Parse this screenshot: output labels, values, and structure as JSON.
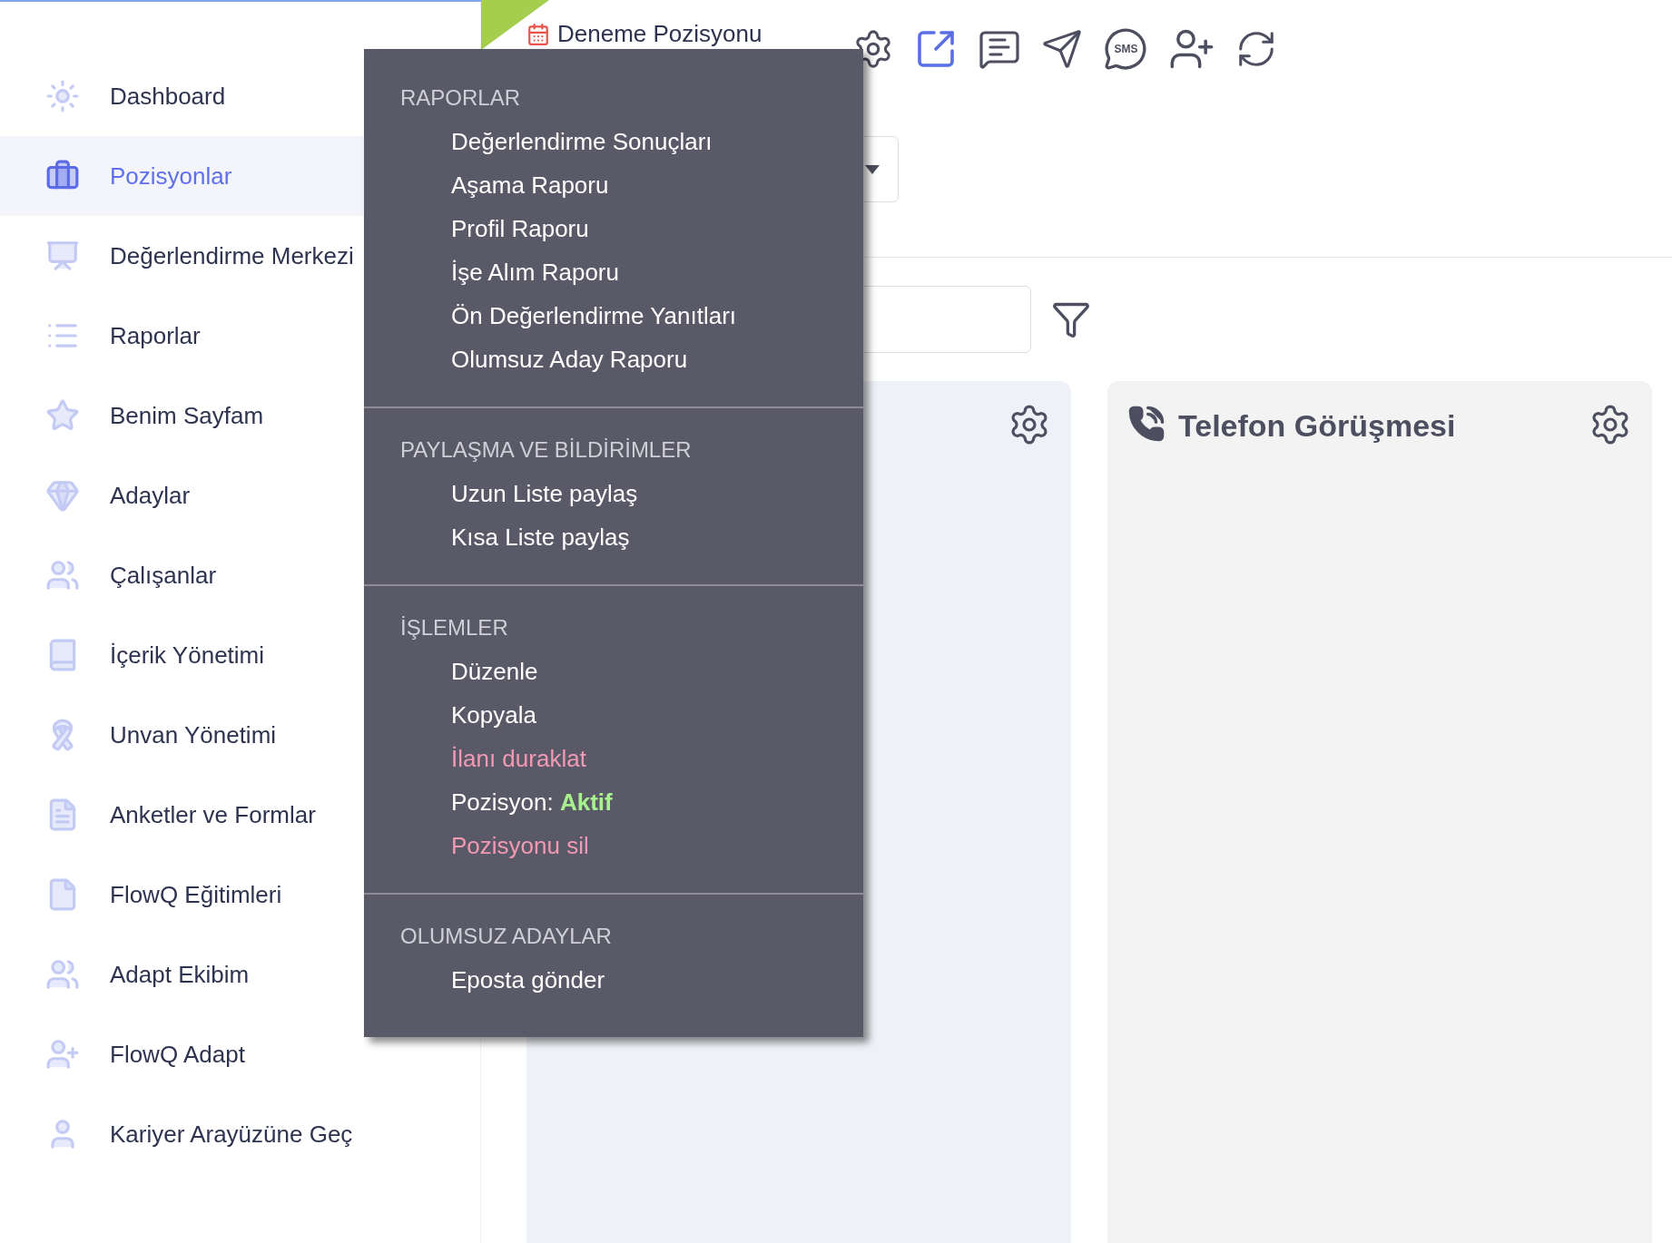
{
  "sidebar": {
    "items": [
      {
        "label": "Dashboard",
        "selected": false
      },
      {
        "label": "Pozisyonlar",
        "selected": true
      },
      {
        "label": "Değerlendirme Merkezi",
        "selected": false
      },
      {
        "label": "Raporlar",
        "selected": false
      },
      {
        "label": "Benim Sayfam",
        "selected": false
      },
      {
        "label": "Adaylar",
        "selected": false
      },
      {
        "label": "Çalışanlar",
        "selected": false
      },
      {
        "label": "İçerik Yönetimi",
        "selected": false
      },
      {
        "label": "Unvan Yönetimi",
        "selected": false
      },
      {
        "label": "Anketler ve Formlar",
        "selected": false
      },
      {
        "label": "FlowQ Eğitimleri",
        "selected": false
      },
      {
        "label": "Adapt Ekibim",
        "selected": false
      },
      {
        "label": "FlowQ Adapt",
        "selected": false
      },
      {
        "label": "Kariyer Arayüzüne Geç",
        "selected": false
      }
    ]
  },
  "header": {
    "title": "Deneme Pozisyonu",
    "sms_label": "SMS"
  },
  "menu": {
    "sections": [
      {
        "heading": "RAPORLAR",
        "items": [
          {
            "label": "Değerlendirme Sonuçları",
            "kind": "normal"
          },
          {
            "label": "Aşama Raporu",
            "kind": "normal"
          },
          {
            "label": "Profil Raporu",
            "kind": "normal"
          },
          {
            "label": "İşe Alım Raporu",
            "kind": "normal"
          },
          {
            "label": "Ön Değerlendirme Yanıtları",
            "kind": "normal"
          },
          {
            "label": "Olumsuz Aday Raporu",
            "kind": "normal"
          }
        ]
      },
      {
        "heading": "PAYLAŞMA VE BİLDİRİMLER",
        "items": [
          {
            "label": "Uzun Liste paylaş",
            "kind": "normal"
          },
          {
            "label": "Kısa Liste paylaş",
            "kind": "normal"
          }
        ]
      },
      {
        "heading": "İŞLEMLER",
        "items": [
          {
            "label": "Düzenle",
            "kind": "normal"
          },
          {
            "label": "Kopyala",
            "kind": "normal"
          },
          {
            "label": "İlanı duraklat",
            "kind": "danger"
          },
          {
            "label": "Pozisyon: **Aktif**",
            "kind": "status"
          },
          {
            "label": "Pozisyonu sil",
            "kind": "danger"
          }
        ]
      },
      {
        "heading": "OLUMSUZ ADAYLAR",
        "items": [
          {
            "label": "Eposta gönder",
            "kind": "normal"
          }
        ]
      }
    ]
  },
  "stages": [
    {
      "title": "Telefon Görüşmesi"
    }
  ]
}
